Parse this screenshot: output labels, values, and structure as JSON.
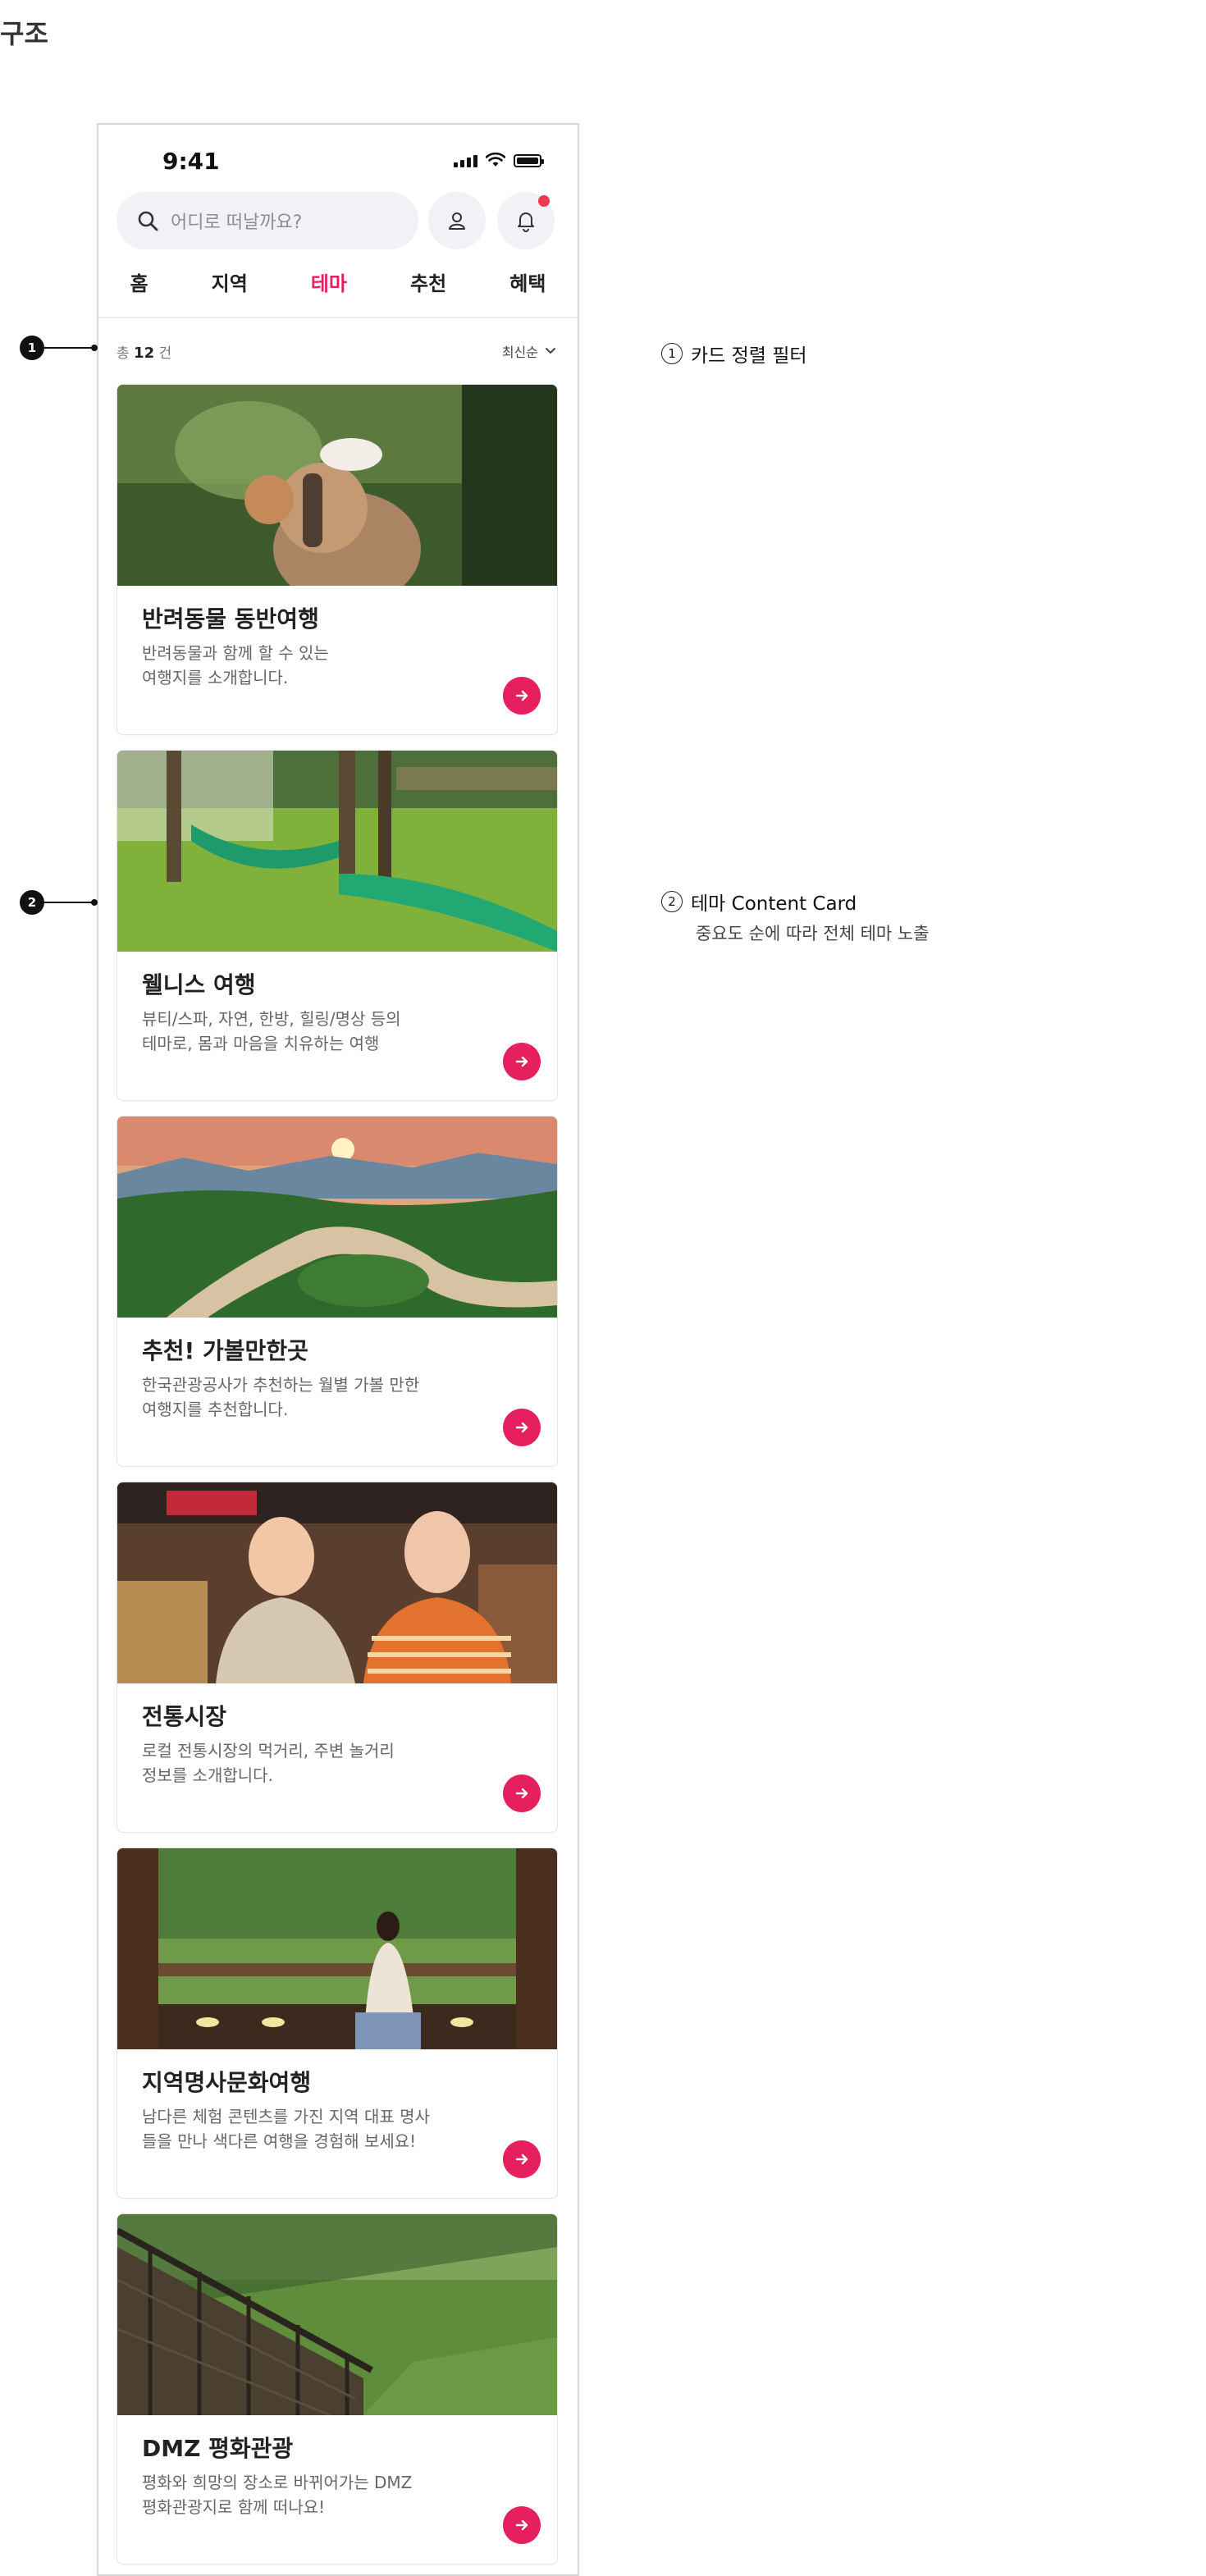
{
  "page_heading": "구조",
  "status": {
    "time": "9:41"
  },
  "search": {
    "placeholder": "어디로 떠날까요?"
  },
  "tabs": [
    {
      "label": "홈"
    },
    {
      "label": "지역"
    },
    {
      "label": "테마",
      "active": true
    },
    {
      "label": "추천"
    },
    {
      "label": "혜택"
    }
  ],
  "list_header": {
    "count_prefix": "총",
    "count_value": "12",
    "count_suffix": "건",
    "sort_label": "최신순"
  },
  "cards": [
    {
      "title": "반려동물 동반여행",
      "desc": "반려동물과 함께 할 수 있는\n여행지를 소개합니다."
    },
    {
      "title": "웰니스 여행",
      "desc": "뷰티/스파, 자연, 한방, 힐링/명상 등의\n테마로, 몸과 마음을 치유하는 여행"
    },
    {
      "title": "추천! 가볼만한곳",
      "desc": "한국관광공사가 추천하는 월별 가볼 만한\n여행지를 추천합니다."
    },
    {
      "title": "전통시장",
      "desc": "로컬 전통시장의 먹거리, 주변 놀거리\n정보를 소개합니다."
    },
    {
      "title": "지역명사문화여행",
      "desc": "남다른 체험 콘텐츠를 가진 지역 대표 명사\n들을 만나 색다른 여행을 경험해 보세요!"
    },
    {
      "title": "DMZ 평화관광",
      "desc": "평화와 희망의 장소로 바뀌어가는 DMZ\n평화관광지로 함께 떠나요!"
    }
  ],
  "annotations": [
    {
      "num": "1",
      "title": "카드 정렬 필터",
      "desc": ""
    },
    {
      "num": "2",
      "title": "테마 Content Card",
      "desc": "중요도 순에 따라 전체 테마 노출"
    }
  ],
  "colors": {
    "accent": "#e6205f",
    "notification_dot": "#e8394d",
    "search_bg": "#f1f2f5"
  }
}
